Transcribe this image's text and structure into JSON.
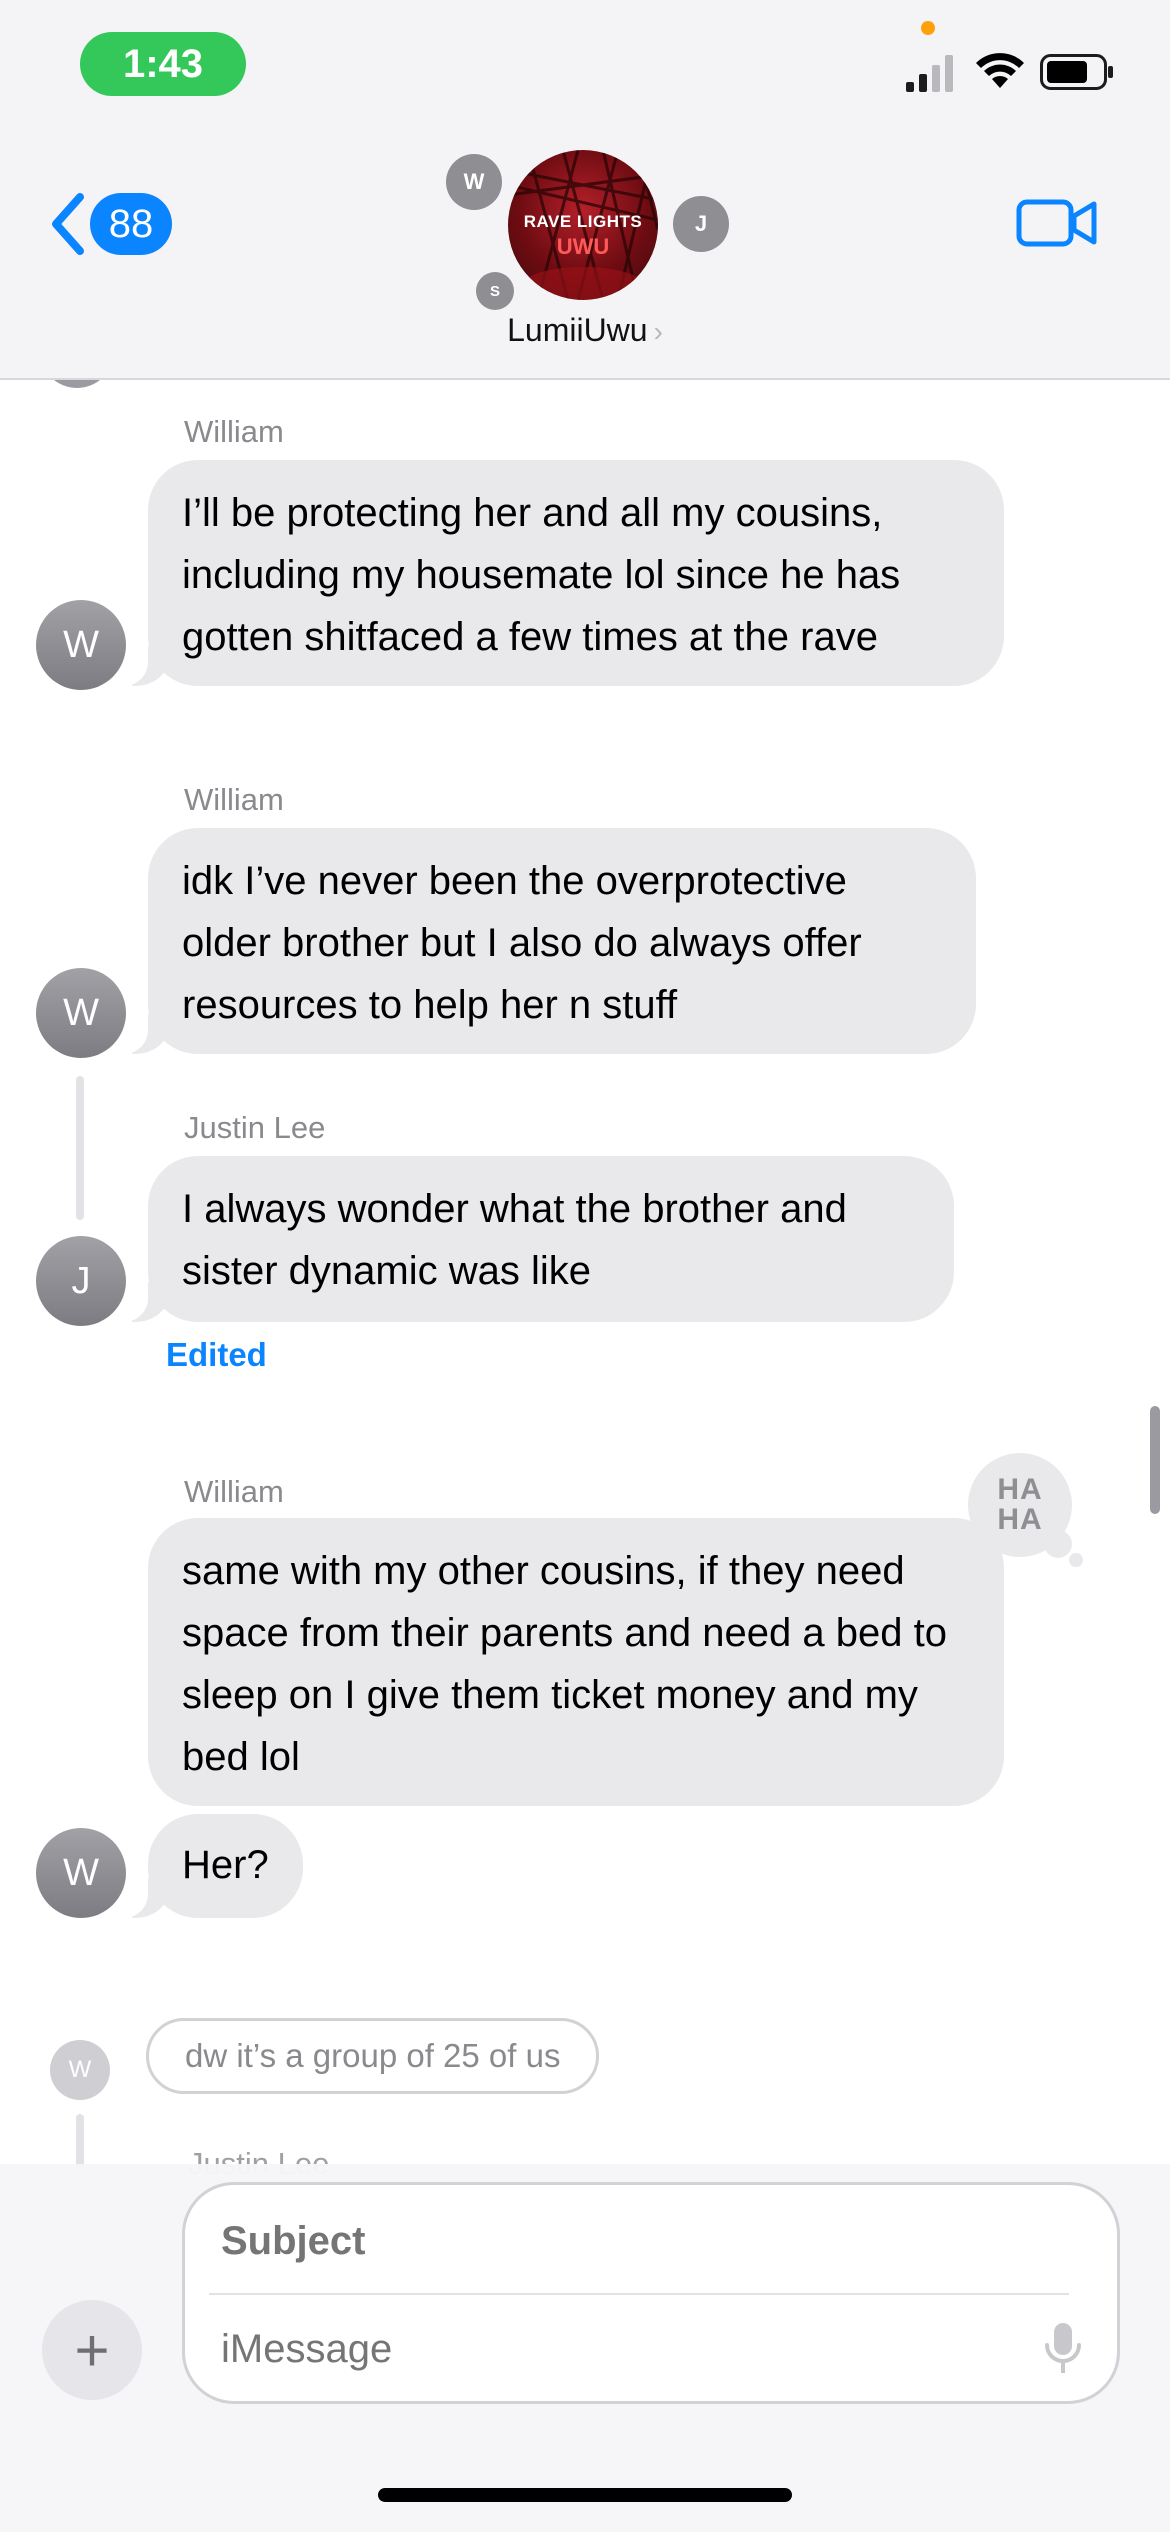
{
  "status_bar": {
    "time": "1:43",
    "signal_icon": "cellular-signal-icon",
    "wifi_icon": "wifi-icon",
    "battery_icon": "battery-icon"
  },
  "header": {
    "back_badge": "88",
    "group_name": "LumiiUwu",
    "group_photo_text_line1": "RAVE LIGHTS",
    "group_photo_text_line2": "UWU",
    "participants": [
      "W",
      "J",
      "S"
    ],
    "video_icon": "video-camera-icon"
  },
  "messages": [
    {
      "sender": "William",
      "avatar": "W",
      "text": "I’ll be protecting her and all my cousins, including my housemate lol since he has gotten shitfaced a few times at the rave"
    },
    {
      "sender": "William",
      "avatar": "W",
      "text": "idk I’ve never been the overprotective older brother but I also do always offer resources to help her n stuff"
    },
    {
      "sender": "Justin Lee",
      "avatar": "J",
      "text": "I always wonder what the brother and sister dynamic was like",
      "status": "Edited"
    },
    {
      "sender": "William",
      "avatar": "W",
      "text": "same with my other cousins, if they need space from their parents and need a bed to sleep on I give them ticket money and my bed lol",
      "reaction": "HA HA"
    },
    {
      "sender": "William",
      "avatar": "W",
      "text": "Her?"
    },
    {
      "avatar": "W",
      "text": "dw it’s a group of 25 of us"
    }
  ],
  "clipped_sender": "Justin Lee",
  "input": {
    "subject_placeholder": "Subject",
    "message_placeholder": "iMessage",
    "plus_label": "+",
    "mic_icon": "microphone-icon"
  }
}
